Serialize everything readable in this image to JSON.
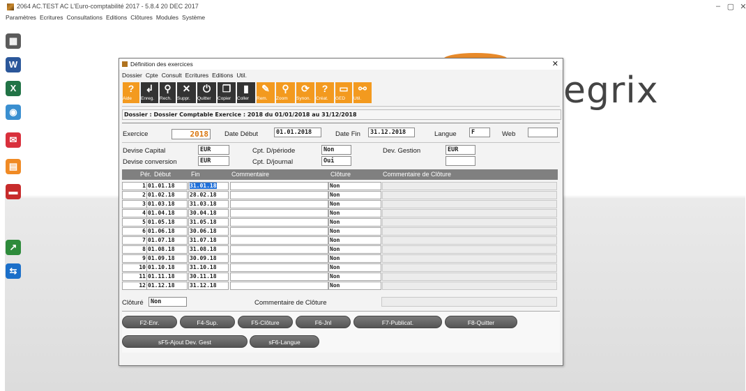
{
  "window": {
    "title": "2064  AC.TEST  AC   L'Euro-comptabilité 2017 - 5.8.4        20 DEC 2017",
    "controls": [
      "–",
      "▢",
      "✕"
    ]
  },
  "app_menu": [
    "Paramètres",
    "Ecritures",
    "Consultations",
    "Editions",
    "Clôtures",
    "Modules",
    "Système"
  ],
  "sidebar_icons": [
    {
      "name": "calculator-icon",
      "glyph": "▦",
      "color": "#5b5b5b"
    },
    {
      "name": "word-icon",
      "glyph": "W",
      "color": "#2b579a"
    },
    {
      "name": "excel-icon",
      "glyph": "X",
      "color": "#217346"
    },
    {
      "name": "globe-icon",
      "glyph": "◉",
      "color": "#3a8fd0"
    },
    {
      "name": "mail-icon",
      "glyph": "✉",
      "color": "#d9303c"
    },
    {
      "name": "calendar-icon",
      "glyph": "▤",
      "color": "#f08a24"
    },
    {
      "name": "document-icon",
      "glyph": "▬",
      "color": "#c72b2b"
    },
    {
      "name": "chart-icon",
      "glyph": "↗",
      "color": "#2e8b3b"
    },
    {
      "name": "teamviewer-icon",
      "glyph": "⇆",
      "color": "#1b6fc9"
    }
  ],
  "brand_text": "egrix",
  "dialog": {
    "title": "Définition des exercices",
    "close_glyph": "✕",
    "menu": [
      "Dossier",
      "Cpte",
      "Consult",
      "Ecritures",
      "Editions",
      "Util."
    ],
    "toolbar": [
      {
        "name": "aide",
        "label": "Aide",
        "glyph": "?",
        "color": "orange",
        "icon": "help-icon"
      },
      {
        "name": "enreg",
        "label": "Enreg.",
        "glyph": "↲",
        "color": "dark",
        "icon": "save-icon"
      },
      {
        "name": "rech",
        "label": "Rech.",
        "glyph": "⚲",
        "color": "dark",
        "icon": "search-icon"
      },
      {
        "name": "suppr",
        "label": "Suppr.",
        "glyph": "✕",
        "color": "dark",
        "icon": "delete-icon"
      },
      {
        "name": "quitter",
        "label": "Quitter",
        "glyph": "⏻",
        "color": "dark",
        "icon": "power-icon"
      },
      {
        "name": "copier",
        "label": "Copier",
        "glyph": "❐",
        "color": "dark",
        "icon": "copy-icon"
      },
      {
        "name": "coller",
        "label": "Coller",
        "glyph": "▮",
        "color": "dark",
        "icon": "paste-icon"
      },
      {
        "name": "rem",
        "label": "Rem.",
        "glyph": "✎",
        "color": "orange",
        "icon": "pencil-icon"
      },
      {
        "name": "zoom",
        "label": "Zoom",
        "glyph": "⚲",
        "color": "orange",
        "icon": "zoom-icon"
      },
      {
        "name": "synon",
        "label": "Synon.",
        "glyph": "⟳",
        "color": "orange",
        "icon": "synonym-icon"
      },
      {
        "name": "creat",
        "label": "Créat.",
        "glyph": "?",
        "color": "orange",
        "icon": "create-icon"
      },
      {
        "name": "ged",
        "label": "GED",
        "glyph": "▭",
        "color": "orange",
        "icon": "folder-icon"
      },
      {
        "name": "util",
        "label": "Util.",
        "glyph": "⚯",
        "color": "orange",
        "icon": "tools-icon"
      }
    ],
    "dossier_line": "Dossier : Dossier Comptable Exercice : 2018 du 01/01/2018 au 31/12/2018",
    "exercice_label": "Exercice",
    "exercice_value": "2018",
    "date_debut_label": "Date Début",
    "date_debut_value": "01.01.2018",
    "date_fin_label": "Date Fin",
    "date_fin_value": "31.12.2018",
    "langue_label": "Langue",
    "langue_value": "F",
    "web_label": "Web",
    "web_value": "",
    "devise_capital_label": "Devise Capital",
    "devise_capital_value": "EUR",
    "devise_conversion_label": "Devise conversion",
    "devise_conversion_value": "EUR",
    "cpt_periode_label": "Cpt. D/période",
    "cpt_periode_value": "Non",
    "cpt_journal_label": "Cpt. D/journal",
    "cpt_journal_value": "Oui",
    "dev_gestion_label": "Dev. Gestion",
    "dev_gestion_value": "EUR",
    "dev_gestion_value2": "",
    "grid_columns": [
      "Pér.",
      "Début",
      "Fin",
      "Commentaire",
      "Clôture",
      "Commentaire de Clôture"
    ],
    "periods": [
      {
        "per": "1",
        "debut": "01.01.18",
        "fin": "31.01.18",
        "commentaire": "",
        "cloture": "Non",
        "comm_cloture": ""
      },
      {
        "per": "2",
        "debut": "01.02.18",
        "fin": "28.02.18",
        "commentaire": "",
        "cloture": "Non",
        "comm_cloture": ""
      },
      {
        "per": "3",
        "debut": "01.03.18",
        "fin": "31.03.18",
        "commentaire": "",
        "cloture": "Non",
        "comm_cloture": ""
      },
      {
        "per": "4",
        "debut": "01.04.18",
        "fin": "30.04.18",
        "commentaire": "",
        "cloture": "Non",
        "comm_cloture": ""
      },
      {
        "per": "5",
        "debut": "01.05.18",
        "fin": "31.05.18",
        "commentaire": "",
        "cloture": "Non",
        "comm_cloture": ""
      },
      {
        "per": "6",
        "debut": "01.06.18",
        "fin": "30.06.18",
        "commentaire": "",
        "cloture": "Non",
        "comm_cloture": ""
      },
      {
        "per": "7",
        "debut": "01.07.18",
        "fin": "31.07.18",
        "commentaire": "",
        "cloture": "Non",
        "comm_cloture": ""
      },
      {
        "per": "8",
        "debut": "01.08.18",
        "fin": "31.08.18",
        "commentaire": "",
        "cloture": "Non",
        "comm_cloture": ""
      },
      {
        "per": "9",
        "debut": "01.09.18",
        "fin": "30.09.18",
        "commentaire": "",
        "cloture": "Non",
        "comm_cloture": ""
      },
      {
        "per": "10",
        "debut": "01.10.18",
        "fin": "31.10.18",
        "commentaire": "",
        "cloture": "Non",
        "comm_cloture": ""
      },
      {
        "per": "11",
        "debut": "01.11.18",
        "fin": "30.11.18",
        "commentaire": "",
        "cloture": "Non",
        "comm_cloture": ""
      },
      {
        "per": "12",
        "debut": "01.12.18",
        "fin": "31.12.18",
        "commentaire": "",
        "cloture": "Non",
        "comm_cloture": ""
      }
    ],
    "cloture_label": "Clôturé",
    "cloture_value": "Non",
    "comm_cloture_label": "Commentaire de Clôture",
    "comm_cloture_value": "",
    "buttons_row1": [
      "F2-Enr.",
      "F4-Sup.",
      "F5-Clôture",
      "F6-Jnl",
      "F7-Publicat.",
      "F8-Quitter"
    ],
    "buttons_row2": [
      "sF5-Ajout Dev. Gest",
      "sF6-Langue"
    ]
  }
}
